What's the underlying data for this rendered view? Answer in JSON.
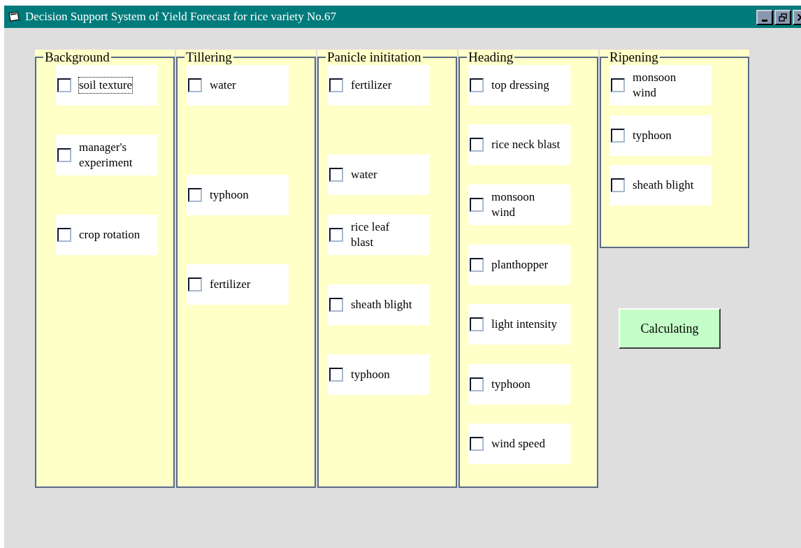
{
  "window": {
    "title": "Decision Support System of Yield Forecast for rice variety No.67"
  },
  "groups": [
    {
      "title": "Background",
      "items": [
        {
          "label": "soil texture",
          "checked": false,
          "focused": true
        },
        {
          "label": "manager's experiment",
          "checked": false,
          "focused": false
        },
        {
          "label": "crop rotation",
          "checked": false,
          "focused": false
        }
      ]
    },
    {
      "title": "Tillering",
      "items": [
        {
          "label": "water",
          "checked": false,
          "focused": false
        },
        {
          "label": "typhoon",
          "checked": false,
          "focused": false
        },
        {
          "label": "fertilizer",
          "checked": false,
          "focused": false
        }
      ]
    },
    {
      "title": "Panicle inititation",
      "items": [
        {
          "label": "fertilizer",
          "checked": false,
          "focused": false
        },
        {
          "label": "water",
          "checked": false,
          "focused": false
        },
        {
          "label": "rice leaf blast",
          "checked": false,
          "focused": false
        },
        {
          "label": "sheath blight",
          "checked": false,
          "focused": false
        },
        {
          "label": "typhoon",
          "checked": false,
          "focused": false
        }
      ]
    },
    {
      "title": "Heading",
      "items": [
        {
          "label": "top dressing",
          "checked": false,
          "focused": false
        },
        {
          "label": "rice neck blast",
          "checked": false,
          "focused": false
        },
        {
          "label": "monsoon wind",
          "checked": false,
          "focused": false
        },
        {
          "label": "planthopper",
          "checked": false,
          "focused": false
        },
        {
          "label": "light intensity",
          "checked": false,
          "focused": false
        },
        {
          "label": "typhoon",
          "checked": false,
          "focused": false
        },
        {
          "label": "wind speed",
          "checked": false,
          "focused": false
        }
      ]
    },
    {
      "title": "Ripening",
      "items": [
        {
          "label": "monsoon wind",
          "checked": false,
          "focused": false
        },
        {
          "label": "typhoon",
          "checked": false,
          "focused": false
        },
        {
          "label": "sheath blight",
          "checked": false,
          "focused": false
        }
      ]
    }
  ],
  "calculate_button": "Calculating"
}
